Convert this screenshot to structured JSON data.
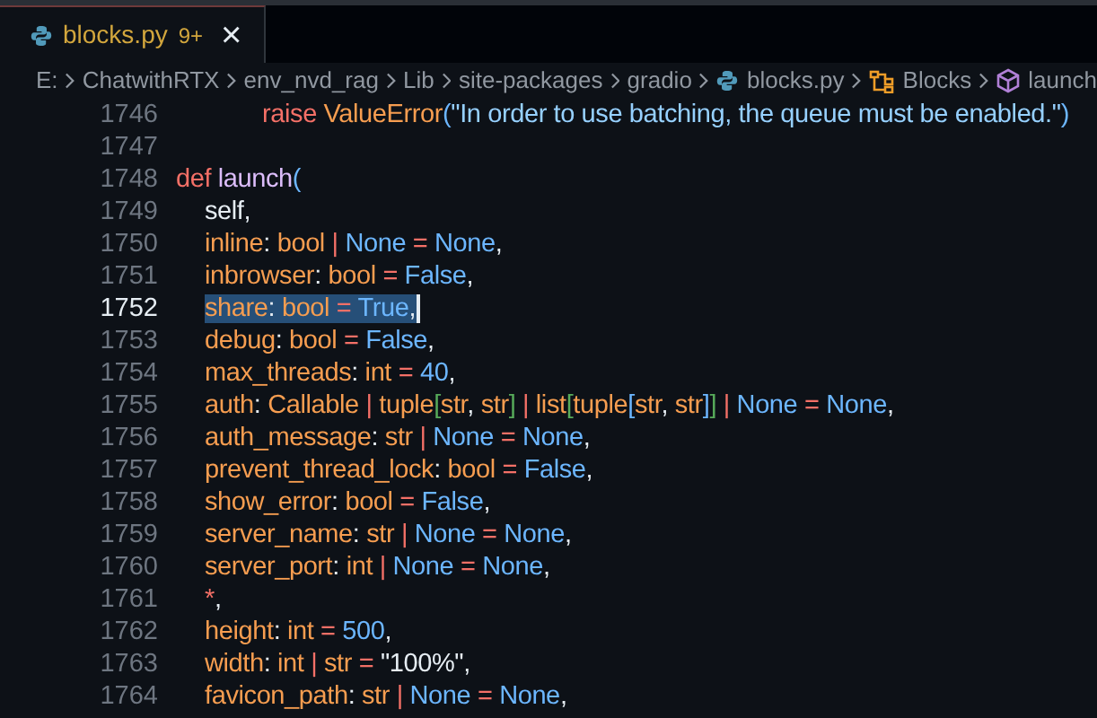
{
  "tabs": [
    {
      "label": "blocks.py",
      "badge": "9+",
      "close": "×",
      "selected": true,
      "kind": "python"
    }
  ],
  "breadcrumb": [
    {
      "text": "E:"
    },
    {
      "text": "ChatwithRTX"
    },
    {
      "text": "env_nvd_rag"
    },
    {
      "text": "Lib"
    },
    {
      "text": "site-packages"
    },
    {
      "text": "gradio"
    },
    {
      "text": "blocks.py",
      "kind": "python"
    },
    {
      "text": "Blocks",
      "kind": "class"
    },
    {
      "text": "launch",
      "kind": "method"
    }
  ],
  "editor": {
    "lines": [
      {
        "children": [
          {
            "children": [
              {
                "children": [
                  {
                    "number": "1746",
                    "selected": false,
                    "tokens": [
                      {
                        "text": "raise ",
                        "kind": "kw"
                      },
                      {
                        "text": "ValueError",
                        "kind": "type"
                      },
                      {
                        "text": "(",
                        "kind": "br2"
                      },
                      {
                        "text": "\"In order to use batching, the queue must be enabled.\"",
                        "kind": "str"
                      },
                      {
                        "text": ")",
                        "kind": "br2"
                      }
                    ]
                  }
                ]
              }
            ]
          }
        ]
      },
      {
        "number": "1747",
        "selected": false
      },
      {
        "number": "1748",
        "selected": false,
        "tokens": [
          {
            "text": "def ",
            "kind": "kw"
          },
          {
            "text": "launch",
            "kind": "fn"
          },
          {
            "text": "(",
            "kind": "br2"
          }
        ],
        "children": [
          {
            "number": "1749",
            "selected": false,
            "tokens": [
              {
                "text": "self,",
                "kind": "punct"
              }
            ]
          },
          {
            "number": "1750",
            "selected": false,
            "tokens": [
              {
                "text": "inline",
                "kind": "param"
              },
              {
                "text": ": ",
                "kind": "punct"
              },
              {
                "text": "bool",
                "kind": "type"
              },
              {
                "text": " | ",
                "kind": "op"
              },
              {
                "text": "None",
                "kind": "const"
              },
              {
                "text": " = ",
                "kind": "op"
              },
              {
                "text": "None",
                "kind": "const"
              },
              {
                "text": ",",
                "kind": "punct"
              }
            ]
          },
          {
            "number": "1751",
            "selected": false,
            "tokens": [
              {
                "text": "inbrowser",
                "kind": "param"
              },
              {
                "text": ": ",
                "kind": "punct"
              },
              {
                "text": "bool",
                "kind": "type"
              },
              {
                "text": " = ",
                "kind": "op"
              },
              {
                "text": "False",
                "kind": "const"
              },
              {
                "text": ",",
                "kind": "punct"
              }
            ]
          },
          {
            "number": "1752",
            "selected": true,
            "tokens": [
              {
                "text": "share",
                "kind": "param"
              },
              {
                "text": ": ",
                "kind": "punct"
              },
              {
                "text": "bool",
                "kind": "type"
              },
              {
                "text": " = ",
                "kind": "op"
              },
              {
                "text": "True",
                "kind": "const"
              },
              {
                "text": ",",
                "kind": "punct"
              }
            ]
          },
          {
            "number": "1753",
            "selected": false,
            "tokens": [
              {
                "text": "debug",
                "kind": "param"
              },
              {
                "text": ": ",
                "kind": "punct"
              },
              {
                "text": "bool",
                "kind": "type"
              },
              {
                "text": " = ",
                "kind": "op"
              },
              {
                "text": "False",
                "kind": "const"
              },
              {
                "text": ",",
                "kind": "punct"
              }
            ]
          },
          {
            "number": "1754",
            "selected": false,
            "tokens": [
              {
                "text": "max_threads",
                "kind": "param"
              },
              {
                "text": ": ",
                "kind": "punct"
              },
              {
                "text": "int",
                "kind": "type"
              },
              {
                "text": " = ",
                "kind": "op"
              },
              {
                "text": "40",
                "kind": "num"
              },
              {
                "text": ",",
                "kind": "punct"
              }
            ]
          },
          {
            "number": "1755",
            "selected": false,
            "tokens": [
              {
                "text": "auth",
                "kind": "param"
              },
              {
                "text": ": ",
                "kind": "punct"
              },
              {
                "text": "Callable",
                "kind": "type"
              },
              {
                "text": " | ",
                "kind": "op"
              },
              {
                "text": "tuple",
                "kind": "type"
              },
              {
                "text": "[",
                "kind": "br1"
              },
              {
                "text": "str",
                "kind": "type"
              },
              {
                "text": ", ",
                "kind": "punct"
              },
              {
                "text": "str",
                "kind": "type"
              },
              {
                "text": "]",
                "kind": "br1"
              },
              {
                "text": " | ",
                "kind": "op"
              },
              {
                "text": "list",
                "kind": "type"
              },
              {
                "text": "[",
                "kind": "br1"
              },
              {
                "text": "tuple",
                "kind": "type"
              },
              {
                "text": "[",
                "kind": "br2"
              },
              {
                "text": "str",
                "kind": "type"
              },
              {
                "text": ", ",
                "kind": "punct"
              },
              {
                "text": "str",
                "kind": "type"
              },
              {
                "text": "]",
                "kind": "br2"
              },
              {
                "text": "]",
                "kind": "br1"
              },
              {
                "text": " | ",
                "kind": "op"
              },
              {
                "text": "None",
                "kind": "const"
              },
              {
                "text": " = ",
                "kind": "op"
              },
              {
                "text": "None",
                "kind": "const"
              },
              {
                "text": ",",
                "kind": "punct"
              }
            ]
          },
          {
            "number": "1756",
            "selected": false,
            "tokens": [
              {
                "text": "auth_message",
                "kind": "param"
              },
              {
                "text": ": ",
                "kind": "punct"
              },
              {
                "text": "str",
                "kind": "type"
              },
              {
                "text": " | ",
                "kind": "op"
              },
              {
                "text": "None",
                "kind": "const"
              },
              {
                "text": " = ",
                "kind": "op"
              },
              {
                "text": "None",
                "kind": "const"
              },
              {
                "text": ",",
                "kind": "punct"
              }
            ]
          },
          {
            "number": "1757",
            "selected": false,
            "tokens": [
              {
                "text": "prevent_thread_lock",
                "kind": "param"
              },
              {
                "text": ": ",
                "kind": "punct"
              },
              {
                "text": "bool",
                "kind": "type"
              },
              {
                "text": " = ",
                "kind": "op"
              },
              {
                "text": "False",
                "kind": "const"
              },
              {
                "text": ",",
                "kind": "punct"
              }
            ]
          },
          {
            "number": "1758",
            "selected": false,
            "tokens": [
              {
                "text": "show_error",
                "kind": "param"
              },
              {
                "text": ": ",
                "kind": "punct"
              },
              {
                "text": "bool",
                "kind": "type"
              },
              {
                "text": " = ",
                "kind": "op"
              },
              {
                "text": "False",
                "kind": "const"
              },
              {
                "text": ",",
                "kind": "punct"
              }
            ]
          },
          {
            "number": "1759",
            "selected": false,
            "tokens": [
              {
                "text": "server_name",
                "kind": "param"
              },
              {
                "text": ": ",
                "kind": "punct"
              },
              {
                "text": "str",
                "kind": "type"
              },
              {
                "text": " | ",
                "kind": "op"
              },
              {
                "text": "None",
                "kind": "const"
              },
              {
                "text": " = ",
                "kind": "op"
              },
              {
                "text": "None",
                "kind": "const"
              },
              {
                "text": ",",
                "kind": "punct"
              }
            ]
          },
          {
            "number": "1760",
            "selected": false,
            "tokens": [
              {
                "text": "server_port",
                "kind": "param"
              },
              {
                "text": ": ",
                "kind": "punct"
              },
              {
                "text": "int",
                "kind": "type"
              },
              {
                "text": " | ",
                "kind": "op"
              },
              {
                "text": "None",
                "kind": "const"
              },
              {
                "text": " = ",
                "kind": "op"
              },
              {
                "text": "None",
                "kind": "const"
              },
              {
                "text": ",",
                "kind": "punct"
              }
            ]
          },
          {
            "number": "1761",
            "selected": false,
            "tokens": [
              {
                "text": "*",
                "kind": "op"
              },
              {
                "text": ",",
                "kind": "punct"
              }
            ]
          },
          {
            "number": "1762",
            "selected": false,
            "tokens": [
              {
                "text": "height",
                "kind": "param"
              },
              {
                "text": ": ",
                "kind": "punct"
              },
              {
                "text": "int",
                "kind": "type"
              },
              {
                "text": " = ",
                "kind": "op"
              },
              {
                "text": "500",
                "kind": "num"
              },
              {
                "text": ",",
                "kind": "punct"
              }
            ]
          },
          {
            "number": "1763",
            "selected": false,
            "tokens": [
              {
                "text": "width",
                "kind": "param"
              },
              {
                "text": ": ",
                "kind": "punct"
              },
              {
                "text": "int",
                "kind": "type"
              },
              {
                "text": " | ",
                "kind": "op"
              },
              {
                "text": "str",
                "kind": "type"
              },
              {
                "text": " = ",
                "kind": "op"
              },
              {
                "text": "\"100%\"",
                "kind": "str2"
              },
              {
                "text": ",",
                "kind": "punct"
              }
            ]
          },
          {
            "number": "1764",
            "selected": false,
            "tokens": [
              {
                "text": "favicon_path",
                "kind": "param"
              },
              {
                "text": ": ",
                "kind": "punct"
              },
              {
                "text": "str",
                "kind": "type"
              },
              {
                "text": " | ",
                "kind": "op"
              },
              {
                "text": "None",
                "kind": "const"
              },
              {
                "text": " = ",
                "kind": "op"
              },
              {
                "text": "None",
                "kind": "const"
              },
              {
                "text": ",",
                "kind": "punct"
              }
            ]
          }
        ]
      }
    ]
  }
}
